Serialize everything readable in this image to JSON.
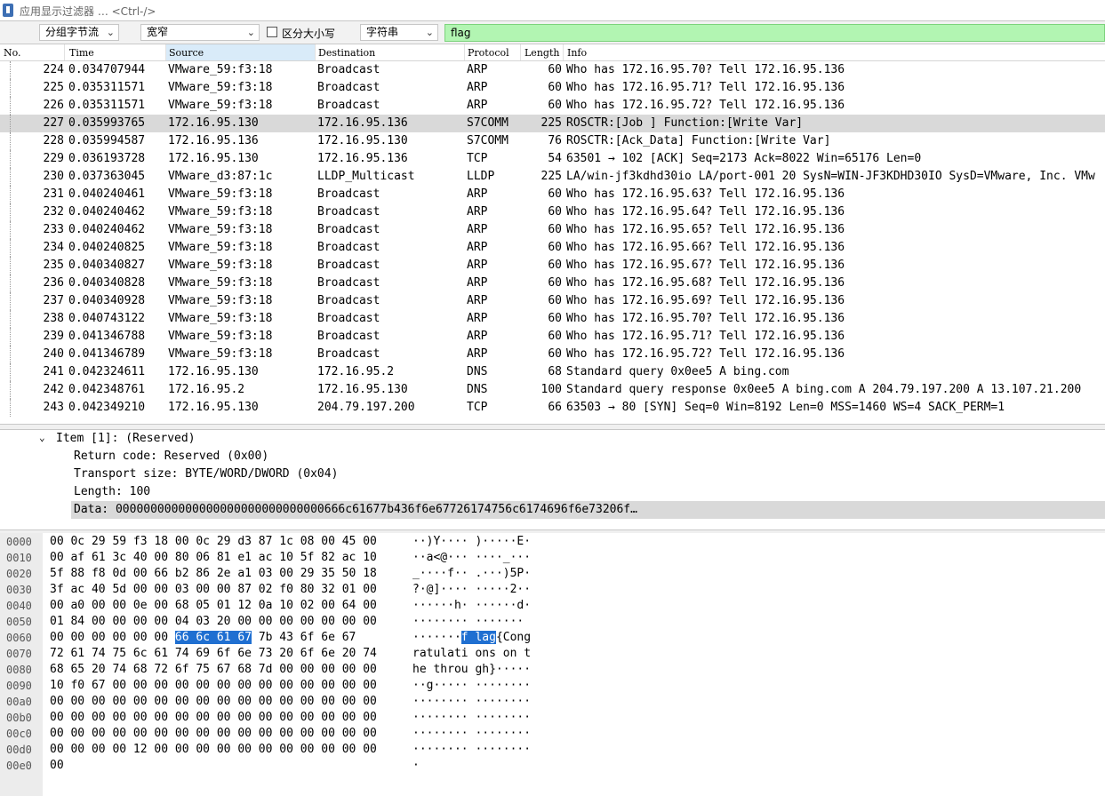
{
  "filter_bar": {
    "placeholder": "应用显示过滤器 … <Ctrl-/>"
  },
  "find_bar": {
    "scope": "分组字节流",
    "charset": "宽窄",
    "case_label": "区分大小写",
    "case_checked": false,
    "search_type": "字符串",
    "search_value": "flag"
  },
  "packet_list": {
    "headers": {
      "no": "No.",
      "time": "Time",
      "source": "Source",
      "destination": "Destination",
      "protocol": "Protocol",
      "length": "Length",
      "info": "Info"
    },
    "selected_no": "227",
    "rows": [
      {
        "no": "224",
        "time": "0.034707944",
        "src": "VMware_59:f3:18",
        "dst": "Broadcast",
        "proto": "ARP",
        "len": "60",
        "info": "Who has 172.16.95.70? Tell 172.16.95.136"
      },
      {
        "no": "225",
        "time": "0.035311571",
        "src": "VMware_59:f3:18",
        "dst": "Broadcast",
        "proto": "ARP",
        "len": "60",
        "info": "Who has 172.16.95.71? Tell 172.16.95.136"
      },
      {
        "no": "226",
        "time": "0.035311571",
        "src": "VMware_59:f3:18",
        "dst": "Broadcast",
        "proto": "ARP",
        "len": "60",
        "info": "Who has 172.16.95.72? Tell 172.16.95.136"
      },
      {
        "no": "227",
        "time": "0.035993765",
        "src": "172.16.95.130",
        "dst": "172.16.95.136",
        "proto": "S7COMM",
        "len": "225",
        "info": "ROSCTR:[Job     ] Function:[Write Var]"
      },
      {
        "no": "228",
        "time": "0.035994587",
        "src": "172.16.95.136",
        "dst": "172.16.95.130",
        "proto": "S7COMM",
        "len": "76",
        "info": "ROSCTR:[Ack_Data] Function:[Write Var]"
      },
      {
        "no": "229",
        "time": "0.036193728",
        "src": "172.16.95.130",
        "dst": "172.16.95.136",
        "proto": "TCP",
        "len": "54",
        "info": "63501 → 102 [ACK] Seq=2173 Ack=8022 Win=65176 Len=0"
      },
      {
        "no": "230",
        "time": "0.037363045",
        "src": "VMware_d3:87:1c",
        "dst": "LLDP_Multicast",
        "proto": "LLDP",
        "len": "225",
        "info": "LA/win-jf3kdhd30io LA/port-001 20 SysN=WIN-JF3KDHD30IO SysD=VMware, Inc. VMw"
      },
      {
        "no": "231",
        "time": "0.040240461",
        "src": "VMware_59:f3:18",
        "dst": "Broadcast",
        "proto": "ARP",
        "len": "60",
        "info": "Who has 172.16.95.63? Tell 172.16.95.136"
      },
      {
        "no": "232",
        "time": "0.040240462",
        "src": "VMware_59:f3:18",
        "dst": "Broadcast",
        "proto": "ARP",
        "len": "60",
        "info": "Who has 172.16.95.64? Tell 172.16.95.136"
      },
      {
        "no": "233",
        "time": "0.040240462",
        "src": "VMware_59:f3:18",
        "dst": "Broadcast",
        "proto": "ARP",
        "len": "60",
        "info": "Who has 172.16.95.65? Tell 172.16.95.136"
      },
      {
        "no": "234",
        "time": "0.040240825",
        "src": "VMware_59:f3:18",
        "dst": "Broadcast",
        "proto": "ARP",
        "len": "60",
        "info": "Who has 172.16.95.66? Tell 172.16.95.136"
      },
      {
        "no": "235",
        "time": "0.040340827",
        "src": "VMware_59:f3:18",
        "dst": "Broadcast",
        "proto": "ARP",
        "len": "60",
        "info": "Who has 172.16.95.67? Tell 172.16.95.136"
      },
      {
        "no": "236",
        "time": "0.040340828",
        "src": "VMware_59:f3:18",
        "dst": "Broadcast",
        "proto": "ARP",
        "len": "60",
        "info": "Who has 172.16.95.68? Tell 172.16.95.136"
      },
      {
        "no": "237",
        "time": "0.040340928",
        "src": "VMware_59:f3:18",
        "dst": "Broadcast",
        "proto": "ARP",
        "len": "60",
        "info": "Who has 172.16.95.69? Tell 172.16.95.136"
      },
      {
        "no": "238",
        "time": "0.040743122",
        "src": "VMware_59:f3:18",
        "dst": "Broadcast",
        "proto": "ARP",
        "len": "60",
        "info": "Who has 172.16.95.70? Tell 172.16.95.136"
      },
      {
        "no": "239",
        "time": "0.041346788",
        "src": "VMware_59:f3:18",
        "dst": "Broadcast",
        "proto": "ARP",
        "len": "60",
        "info": "Who has 172.16.95.71? Tell 172.16.95.136"
      },
      {
        "no": "240",
        "time": "0.041346789",
        "src": "VMware_59:f3:18",
        "dst": "Broadcast",
        "proto": "ARP",
        "len": "60",
        "info": "Who has 172.16.95.72? Tell 172.16.95.136"
      },
      {
        "no": "241",
        "time": "0.042324611",
        "src": "172.16.95.130",
        "dst": "172.16.95.2",
        "proto": "DNS",
        "len": "68",
        "info": "Standard query 0x0ee5 A bing.com"
      },
      {
        "no": "242",
        "time": "0.042348761",
        "src": "172.16.95.2",
        "dst": "172.16.95.130",
        "proto": "DNS",
        "len": "100",
        "info": "Standard query response 0x0ee5 A bing.com A 204.79.197.200 A 13.107.21.200"
      },
      {
        "no": "243",
        "time": "0.042349210",
        "src": "172.16.95.130",
        "dst": "204.79.197.200",
        "proto": "TCP",
        "len": "66",
        "info": "63503 → 80 [SYN] Seq=0 Win=8192 Len=0 MSS=1460 WS=4 SACK_PERM=1"
      }
    ]
  },
  "details": {
    "item": "Item [1]: (Reserved)",
    "return_code": "Return code: Reserved (0x00)",
    "transport_size": "Transport size: BYTE/WORD/DWORD (0x04)",
    "length": "Length: 100",
    "data": "Data: 000000000000000000000000000000666c61677b436f6e67726174756c6174696f6e73206f…"
  },
  "bytes": {
    "highlight_color": "#1f6fd1",
    "rows": [
      {
        "off": "0000",
        "hex_a": "00 0c 29 59 f3 18 00 0c",
        "hex_b": "29 d3 87 1c 08 00 45 00",
        "asc_a": "··)Y····",
        "asc_b": ")·····E·"
      },
      {
        "off": "0010",
        "hex_a": "00 af 61 3c 40 00 80 06",
        "hex_b": "81 e1 ac 10 5f 82 ac 10",
        "asc_a": "··a<@···",
        "asc_b": "····_···"
      },
      {
        "off": "0020",
        "hex_a": "5f 88 f8 0d 00 66 b2 86",
        "hex_b": "2e a1 03 00 29 35 50 18",
        "asc_a": "_····f··",
        "asc_b": ".···)5P·"
      },
      {
        "off": "0030",
        "hex_a": "3f ac 40 5d 00 00 03 00",
        "hex_b": "00 87 02 f0 80 32 01 00",
        "asc_a": "?·@]····",
        "asc_b": "·····2··"
      },
      {
        "off": "0040",
        "hex_a": "00 a0 00 00 0e 00 68 05",
        "hex_b": "01 12 0a 10 02 00 64 00",
        "asc_a": "······h·",
        "asc_b": "······d·"
      },
      {
        "off": "0050",
        "hex_a": "01 84 00 00 00 00 04 03",
        "hex_b": "20 00 00 00 00 00 00 00",
        "asc_a": "········",
        "asc_b": " ·······"
      },
      {
        "off": "0060",
        "hex_a": "00 00 00 00 00 00",
        "hex_hl": "66 6c 61 67",
        "hex_b": "7b 43 6f 6e 67",
        "asc_a": "·······",
        "asc_hl": "f lag",
        "asc_b": "{Cong"
      },
      {
        "off": "0070",
        "hex_a": "72 61 74 75 6c 61 74 69",
        "hex_b": "6f 6e 73 20 6f 6e 20 74",
        "asc_a": "ratulati",
        "asc_b": "ons on t"
      },
      {
        "off": "0080",
        "hex_a": "68 65 20 74 68 72 6f 75",
        "hex_b": "67 68 7d 00 00 00 00 00",
        "asc_a": "he throu",
        "asc_b": "gh}·····"
      },
      {
        "off": "0090",
        "hex_a": "10 f0 67 00 00 00 00 00",
        "hex_b": "00 00 00 00 00 00 00 00",
        "asc_a": "··g·····",
        "asc_b": "········"
      },
      {
        "off": "00a0",
        "hex_a": "00 00 00 00 00 00 00 00",
        "hex_b": "00 00 00 00 00 00 00 00",
        "asc_a": "········",
        "asc_b": "········"
      },
      {
        "off": "00b0",
        "hex_a": "00 00 00 00 00 00 00 00",
        "hex_b": "00 00 00 00 00 00 00 00",
        "asc_a": "········",
        "asc_b": "········"
      },
      {
        "off": "00c0",
        "hex_a": "00 00 00 00 00 00 00 00",
        "hex_b": "00 00 00 00 00 00 00 00",
        "asc_a": "········",
        "asc_b": "········"
      },
      {
        "off": "00d0",
        "hex_a": "00 00 00 00 12 00 00 00",
        "hex_b": "00 00 00 00 00 00 00 00",
        "asc_a": "········",
        "asc_b": "········"
      },
      {
        "off": "00e0",
        "hex_a": "00",
        "hex_b": "",
        "asc_a": "·",
        "asc_b": ""
      }
    ]
  }
}
